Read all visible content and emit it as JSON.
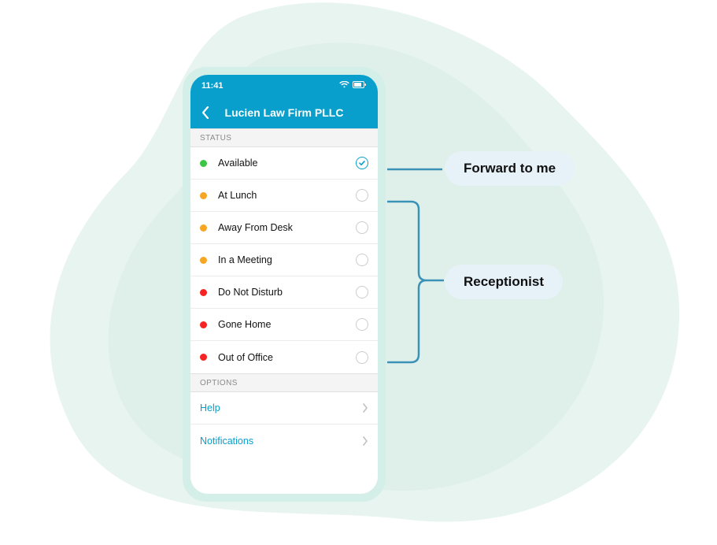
{
  "statusbar": {
    "time": "11:41"
  },
  "navbar": {
    "title": "Lucien Law Firm PLLC"
  },
  "sections": {
    "status_header": "STATUS",
    "options_header": "OPTIONS"
  },
  "status_items": [
    {
      "label": "Available",
      "color": "#3bc641",
      "selected": true
    },
    {
      "label": "At Lunch",
      "color": "#f6a623",
      "selected": false
    },
    {
      "label": "Away From Desk",
      "color": "#f6a623",
      "selected": false
    },
    {
      "label": "In a Meeting",
      "color": "#f6a623",
      "selected": false
    },
    {
      "label": "Do Not Disturb",
      "color": "#f62323",
      "selected": false
    },
    {
      "label": "Gone Home",
      "color": "#f62323",
      "selected": false
    },
    {
      "label": "Out of Office",
      "color": "#f62323",
      "selected": false
    }
  ],
  "options": [
    {
      "label": "Help"
    },
    {
      "label": "Notifications"
    }
  ],
  "callouts": {
    "forward": "Forward to me",
    "receptionist": "Receptionist"
  }
}
